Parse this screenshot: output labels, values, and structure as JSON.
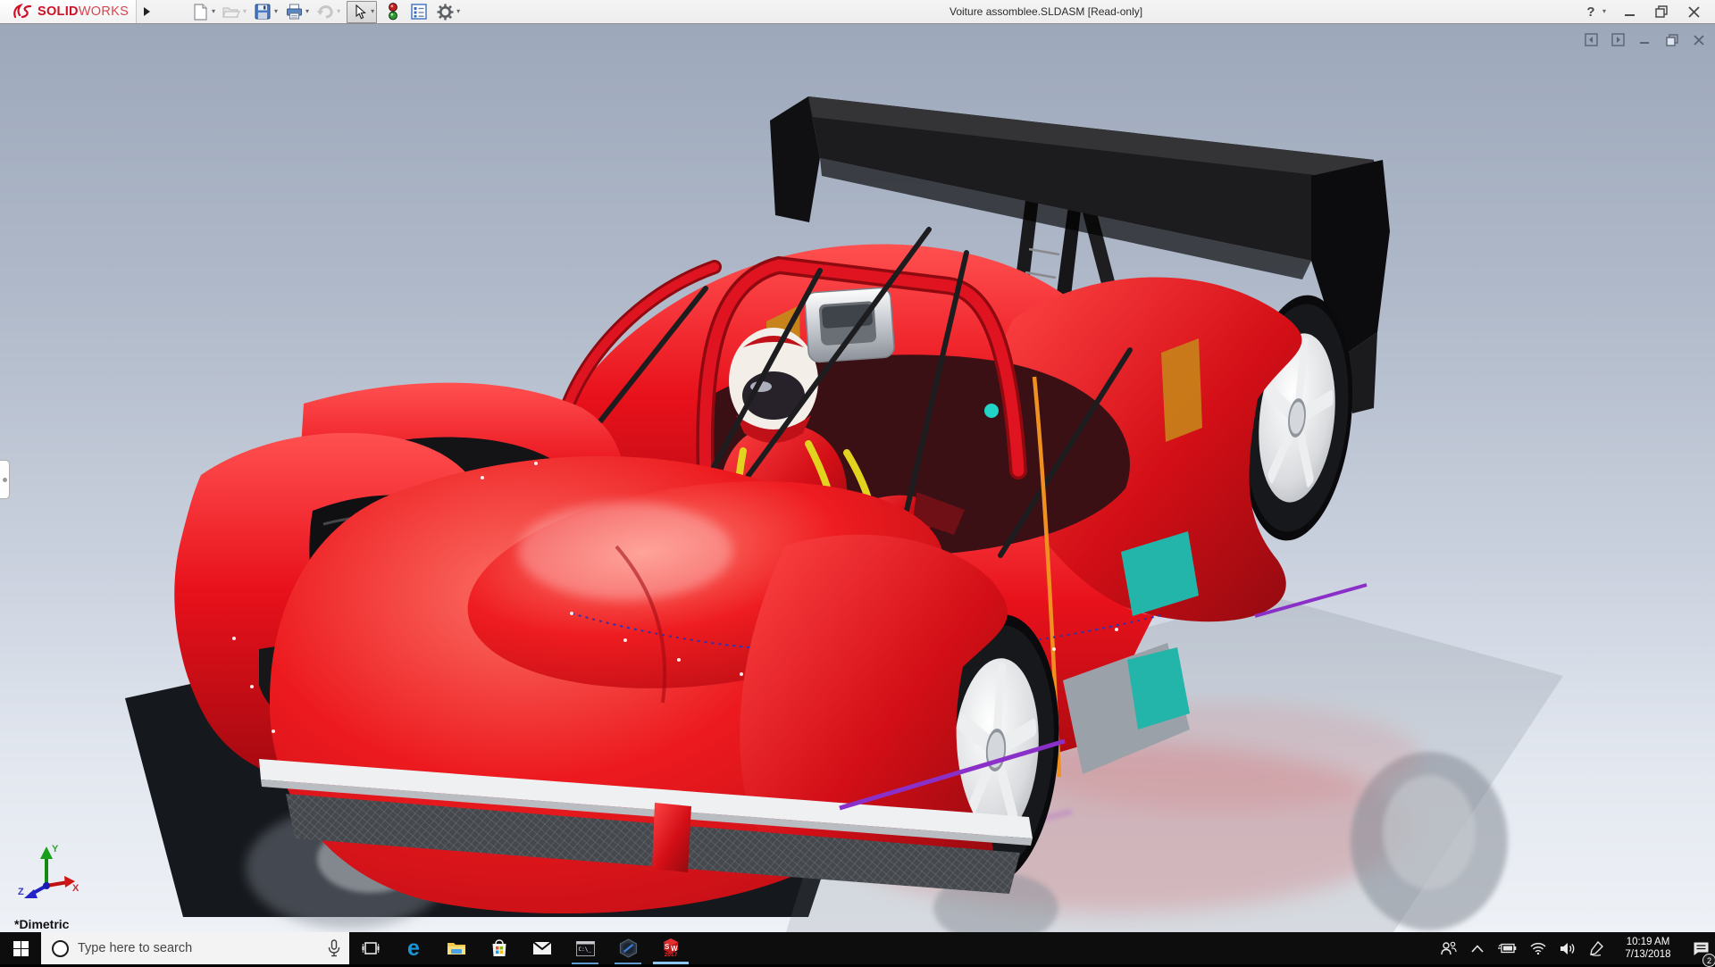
{
  "window": {
    "brand_solid": "SOLID",
    "brand_works": "WORKS",
    "title": "Voiture assomblee.SLDASM [Read-only]",
    "help_label": "?"
  },
  "viewport": {
    "orientation_label": "*Dimetric",
    "triad": {
      "x_label": "X",
      "y_label": "Y",
      "z_label": "Z"
    },
    "colors": {
      "body_red": "#e41018",
      "wing_black": "#1c1c1e",
      "trim_purple": "#8b2fc9",
      "accent_teal": "#23b5a9",
      "helmet_white": "#f3efe8"
    }
  },
  "taskbar": {
    "search_placeholder": "Type here to search",
    "clock_time": "10:19 AM",
    "clock_date": "7/13/2018",
    "notification_count": "2"
  }
}
